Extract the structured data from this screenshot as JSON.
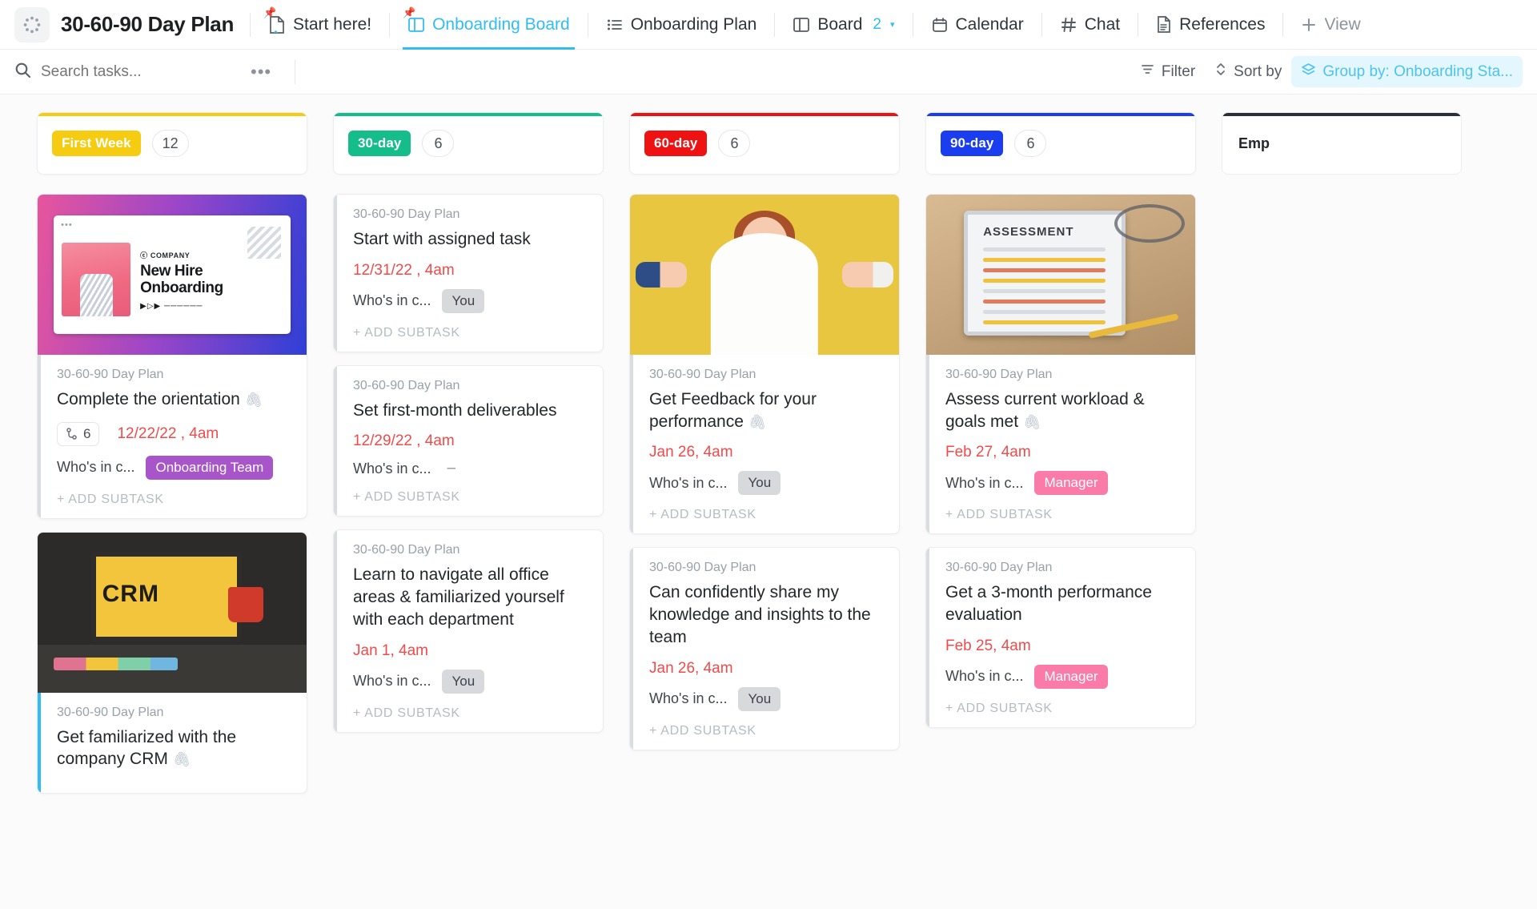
{
  "header": {
    "app_icon": "loading-spinner-icon",
    "title": "30-60-90 Day Plan",
    "nav": [
      {
        "label": "Start here!",
        "icon": "doc-home-icon",
        "active": false,
        "pinned": true
      },
      {
        "label": "Onboarding Board",
        "icon": "board-icon",
        "active": true,
        "pinned": true
      },
      {
        "label": "Onboarding Plan",
        "icon": "list-icon",
        "active": false,
        "pinned": false
      },
      {
        "label": "Board",
        "icon": "board-icon",
        "active": false,
        "count": "2",
        "caret": "▾"
      },
      {
        "label": "Calendar",
        "icon": "calendar-icon",
        "active": false
      },
      {
        "label": "Chat",
        "icon": "hash-icon",
        "active": false
      },
      {
        "label": "References",
        "icon": "document-icon",
        "active": false
      },
      {
        "label": "View",
        "icon": "plus-icon",
        "active": false,
        "muted": true
      }
    ]
  },
  "toolbar": {
    "search_placeholder": "Search tasks...",
    "search_value": "",
    "more_label": "•••",
    "filter_label": "Filter",
    "sort_label": "Sort by",
    "group_label": "Group by: Onboarding Sta..."
  },
  "colors": {
    "accent": "#31bdf4",
    "first_week": "#f5cc12",
    "thirty_day": "#15bd8a",
    "sixty_day": "#ee1212",
    "ninety_day": "#1a3df0",
    "employee": "#2b2f36",
    "due_red": "#f24a4a",
    "tag_team": "#a855c9",
    "tag_manager": "#fa7aa8",
    "tag_you": "#d7d9dd",
    "group_pill_bg": "#e5f7fe"
  },
  "columns": [
    {
      "status": "First Week",
      "status_color": "#f5cc12",
      "count": "12",
      "cards": [
        {
          "cover": "onboarding-video-cover",
          "cover_text": {
            "company": "ⓒ COMPANY",
            "heading_line1": "New Hire",
            "heading_line2": "Onboarding"
          },
          "crumb": "30-60-90 Day Plan",
          "title": "Complete the orientation",
          "has_attachment": true,
          "subtask_count": "6",
          "due": "12/22/22 , 4am",
          "field_label": "Who's in c...",
          "tag": "Onboarding Team",
          "tag_kind": "team",
          "add_subtask": "+ ADD SUBTASK",
          "left_bar": "#d9dce0"
        },
        {
          "cover": "crm-desk-cover",
          "cover_text": {
            "word": "CRM"
          },
          "crumb": "30-60-90 Day Plan",
          "title": "Get familiarized with the company CRM",
          "has_attachment": true,
          "due": "",
          "add_subtask": "+ ADD SUBTASK",
          "left_bar": "#31bdf4"
        }
      ]
    },
    {
      "status": "30-day",
      "status_color": "#15bd8a",
      "count": "6",
      "cards": [
        {
          "crumb": "30-60-90 Day Plan",
          "title": "Start with assigned task",
          "due": "12/31/22 , 4am",
          "field_label": "Who's in c...",
          "tag": "You",
          "tag_kind": "you",
          "add_subtask": "+ ADD SUBTASK",
          "left_bar": "#d9dce0"
        },
        {
          "crumb": "30-60-90 Day Plan",
          "title": "Set first-month deliverables",
          "due": "12/29/22 , 4am",
          "field_label": "Who's in c...",
          "tag": "–",
          "tag_kind": "none",
          "add_subtask": "+ ADD SUBTASK",
          "left_bar": "#d9dce0"
        },
        {
          "crumb": "30-60-90 Day Plan",
          "title": "Learn to navigate all office areas & familiarized yourself with each department",
          "due": "Jan 1, 4am",
          "field_label": "Who's in c...",
          "tag": "You",
          "tag_kind": "you",
          "add_subtask": "+ ADD SUBTASK",
          "left_bar": "#d9dce0"
        }
      ]
    },
    {
      "status": "60-day",
      "status_color": "#ee1212",
      "count": "6",
      "cards": [
        {
          "cover": "feedback-photo-cover",
          "crumb": "30-60-90 Day Plan",
          "title": "Get Feedback for your performance",
          "has_attachment": true,
          "due": "Jan 26, 4am",
          "field_label": "Who's in c...",
          "tag": "You",
          "tag_kind": "you",
          "add_subtask": "+ ADD SUBTASK",
          "left_bar": "#d9dce0"
        },
        {
          "crumb": "30-60-90 Day Plan",
          "title": "Can confidently share my knowledge and insights to the team",
          "due": "Jan 26, 4am",
          "field_label": "Who's in c...",
          "tag": "You",
          "tag_kind": "you",
          "add_subtask": "+ ADD SUBTASK",
          "left_bar": "#d9dce0"
        }
      ]
    },
    {
      "status": "90-day",
      "status_color": "#1a3df0",
      "count": "6",
      "cards": [
        {
          "cover": "assessment-tablet-cover",
          "cover_text": {
            "word": "ASSESSMENT"
          },
          "crumb": "30-60-90 Day Plan",
          "title": "Assess current workload & goals met",
          "has_attachment": true,
          "due": "Feb 27, 4am",
          "field_label": "Who's in c...",
          "tag": "Manager",
          "tag_kind": "manager",
          "add_subtask": "+ ADD SUBTASK",
          "left_bar": "#d9dce0"
        },
        {
          "crumb": "30-60-90 Day Plan",
          "title": "Get a 3-month performance evaluation",
          "due": "Feb 25, 4am",
          "field_label": "Who's in c...",
          "tag": "Manager",
          "tag_kind": "manager",
          "add_subtask": "+ ADD SUBTASK",
          "left_bar": "#d9dce0"
        }
      ]
    }
  ],
  "edge_column": {
    "label": "Emp",
    "status_color": "#2b2f36"
  }
}
